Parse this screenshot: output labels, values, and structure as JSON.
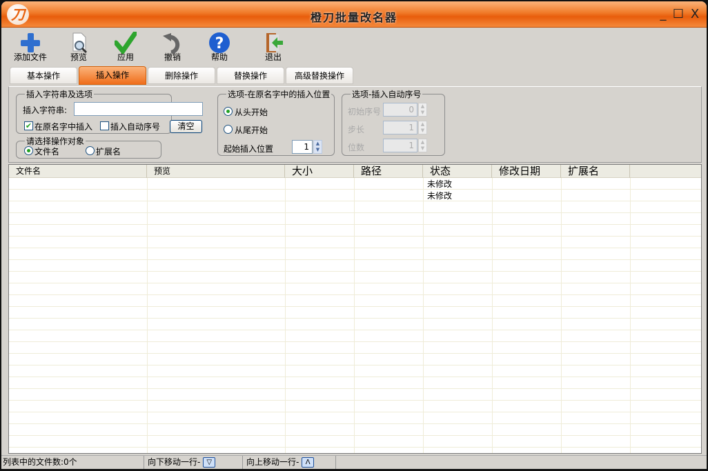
{
  "window": {
    "title": "橙刀批量改名器",
    "logo": "刀",
    "minimize": "_",
    "maximize": "☐",
    "close": "X"
  },
  "toolbar": [
    {
      "label": "添加文件",
      "icon": "plus-icon"
    },
    {
      "label": "预览",
      "icon": "preview-icon"
    },
    {
      "label": "应用",
      "icon": "check-icon"
    },
    {
      "label": "撤销",
      "icon": "undo-icon"
    },
    {
      "label": "帮助",
      "icon": "help-icon"
    },
    {
      "label": "退出",
      "icon": "exit-icon"
    }
  ],
  "tabs": [
    "基本操作",
    "插入操作",
    "删除操作",
    "替换操作",
    "高级替换操作"
  ],
  "active_tab": 1,
  "insert_group": {
    "legend": "插入字符串及选项",
    "string_label": "插入字符串:",
    "string_value": "",
    "in_name_label": "在原名字中插入",
    "in_name_checked": true,
    "auto_seq_label": "插入自动序号",
    "auto_seq_checked": false,
    "clear_label": "清空"
  },
  "target_group": {
    "legend": "请选择操作对象",
    "filename": "文件名",
    "extension": "扩展名",
    "selected": "文件名"
  },
  "position_group": {
    "legend": "选项-在原名字中的插入位置",
    "from_start": "从头开始",
    "from_end": "从尾开始",
    "selected": "从头开始",
    "start_pos_label": "起始插入位置",
    "start_pos_value": "1"
  },
  "seq_group": {
    "legend": "选项-插入自动序号",
    "start_label": "初始序号",
    "start_value": "0",
    "step_label": "步长",
    "step_value": "1",
    "digits_label": "位数",
    "digits_value": "1"
  },
  "table": {
    "columns": [
      "文件名",
      "预览",
      "大小",
      "路径",
      "状态",
      "修改日期",
      "扩展名"
    ],
    "rows": [
      [
        "",
        "",
        "",
        "",
        "未修改",
        "",
        ""
      ],
      [
        "",
        "",
        "",
        "",
        "未修改",
        "",
        ""
      ]
    ]
  },
  "status": {
    "count": "列表中的文件数:0个",
    "down_label": "向下移动一行-",
    "down_btn": "▽",
    "up_label": "向上移动一行-",
    "up_btn": "Λ"
  }
}
